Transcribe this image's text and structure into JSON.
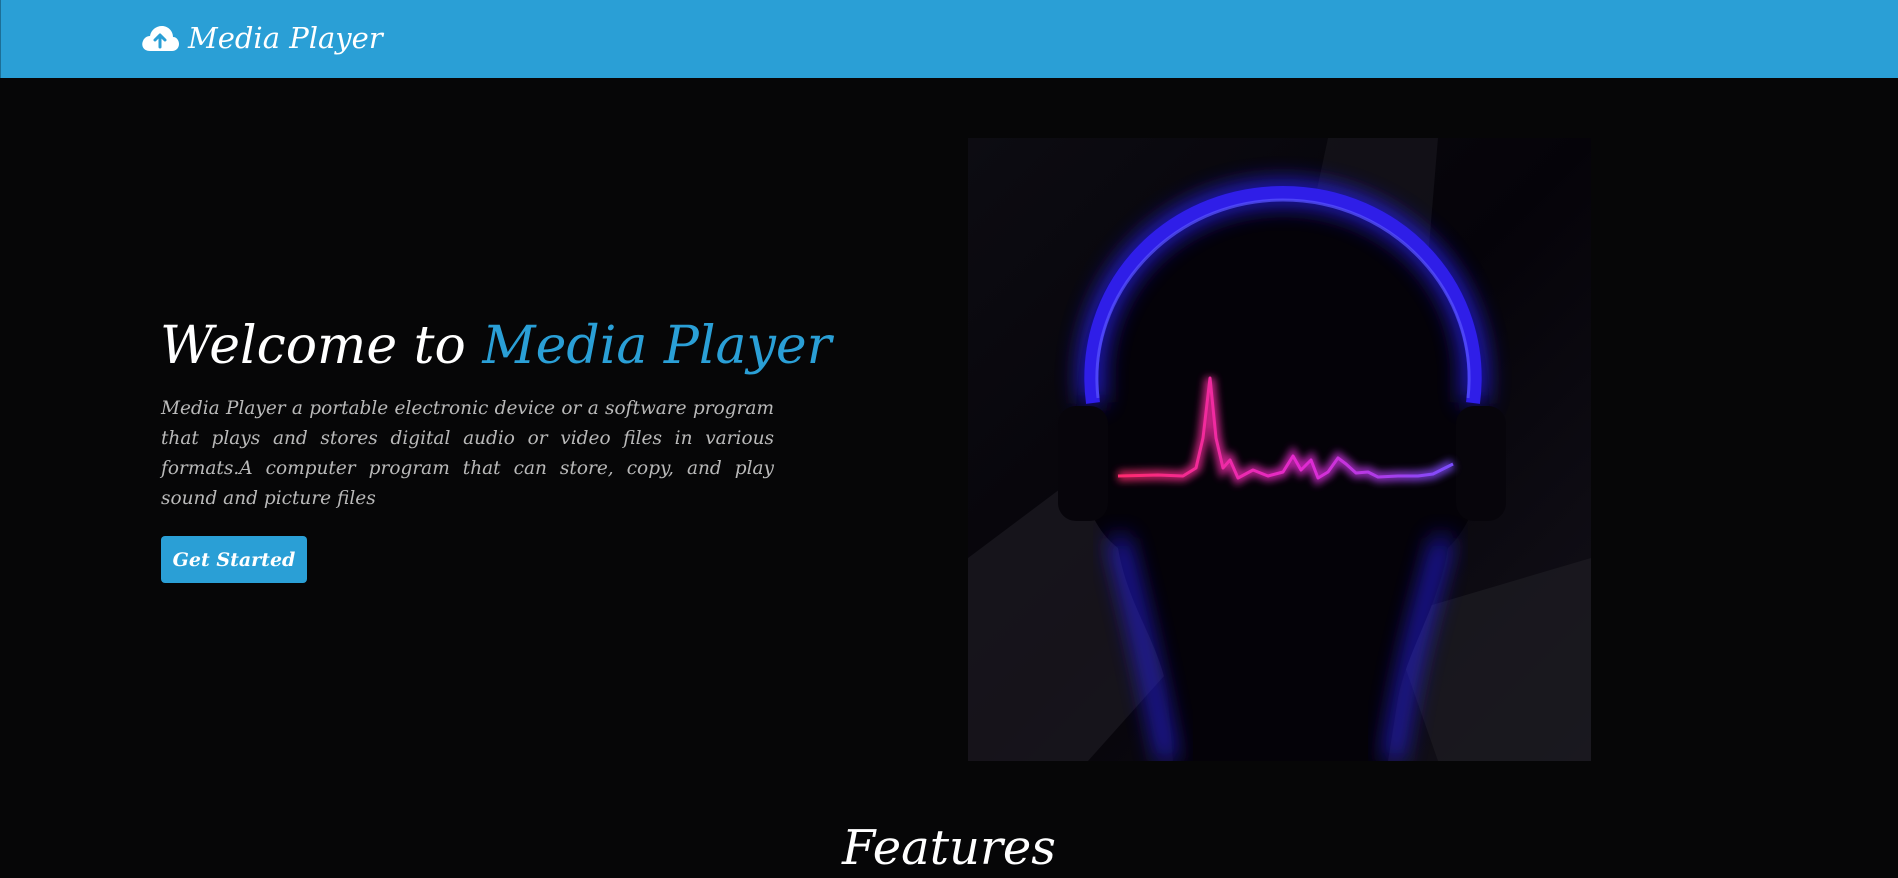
{
  "navbar": {
    "brand_icon": "cloud-upload-icon",
    "brand_label": "Media Player",
    "background": "#2a9fd6"
  },
  "hero": {
    "title_prefix": "Welcome to ",
    "title_accent": "Media Player",
    "accent_color": "#2a9fd6",
    "description": "Media Player a portable electronic device or a software program that plays and stores digital audio or video files in various formats.A computer program that can store, copy, and play sound and picture files",
    "cta_label": "Get Started",
    "image": "headphones-soundwave-illustration"
  },
  "features": {
    "heading": "Features"
  }
}
